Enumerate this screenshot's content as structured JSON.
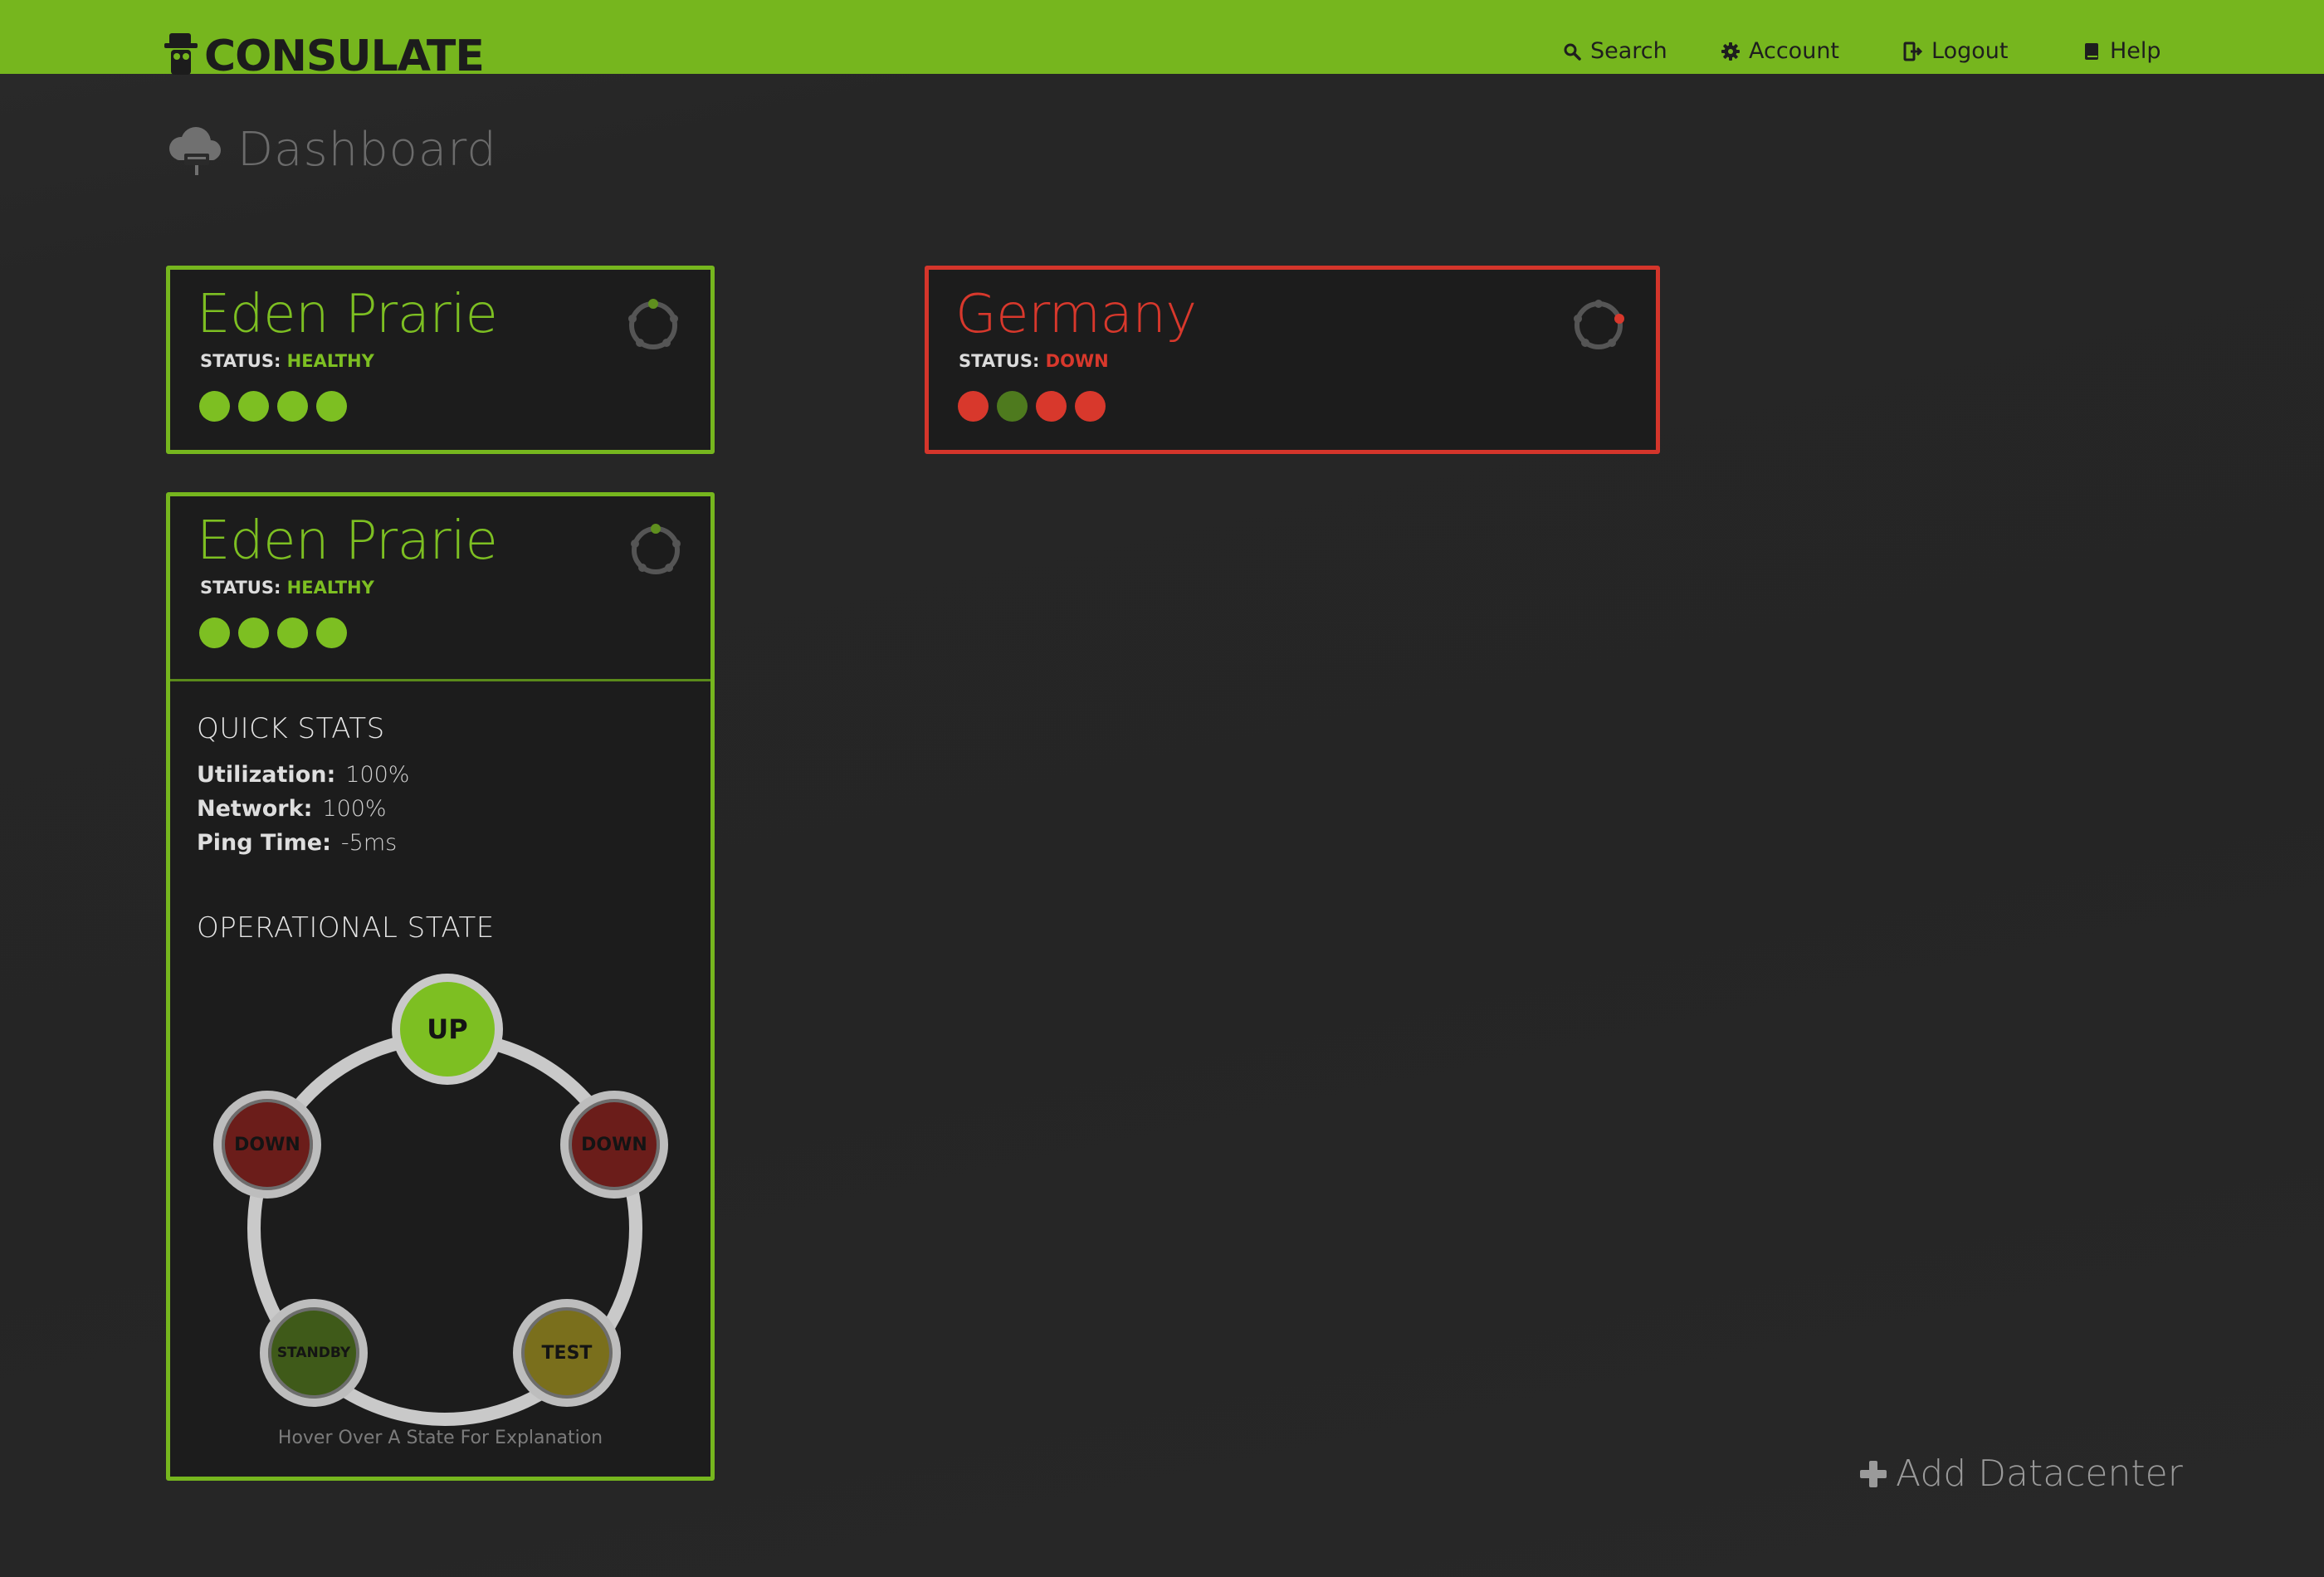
{
  "app": {
    "logo_text": "CONSULATE"
  },
  "nav": {
    "search": "Search",
    "account": "Account",
    "logout": "Logout",
    "help": "Help"
  },
  "page": {
    "title": "Dashboard"
  },
  "colors": {
    "accent": "#76b61e",
    "healthy": "#7dbf22",
    "down": "#d4352b",
    "standby": "#3f5a19",
    "test": "#7a6f1c",
    "down_node": "#6b1d1a"
  },
  "datacenters": [
    {
      "name": "Eden Prarie",
      "status_label": "STATUS:",
      "status": "HEALTHY",
      "indicators": [
        "healthy",
        "healthy",
        "healthy",
        "healthy"
      ]
    },
    {
      "name": "Germany",
      "status_label": "STATUS:",
      "status": "DOWN",
      "indicators": [
        "down",
        "standby",
        "down",
        "down"
      ]
    },
    {
      "name": "Eden Prarie",
      "status_label": "STATUS:",
      "status": "HEALTHY",
      "indicators": [
        "healthy",
        "healthy",
        "healthy",
        "healthy"
      ],
      "quick_stats": {
        "title": "QUICK STATS",
        "rows": [
          {
            "label": "Utilization:",
            "value": "100%"
          },
          {
            "label": "Network:",
            "value": "100%"
          },
          {
            "label": "Ping Time:",
            "value": "-5ms"
          }
        ]
      },
      "operational_state": {
        "title": "OPERATIONAL STATE",
        "states": [
          "UP",
          "DOWN",
          "DOWN",
          "STANDBY",
          "TEST"
        ],
        "active": "UP",
        "hint": "Hover Over A State For Explanation"
      }
    }
  ],
  "add_datacenter": "Add Datacenter"
}
